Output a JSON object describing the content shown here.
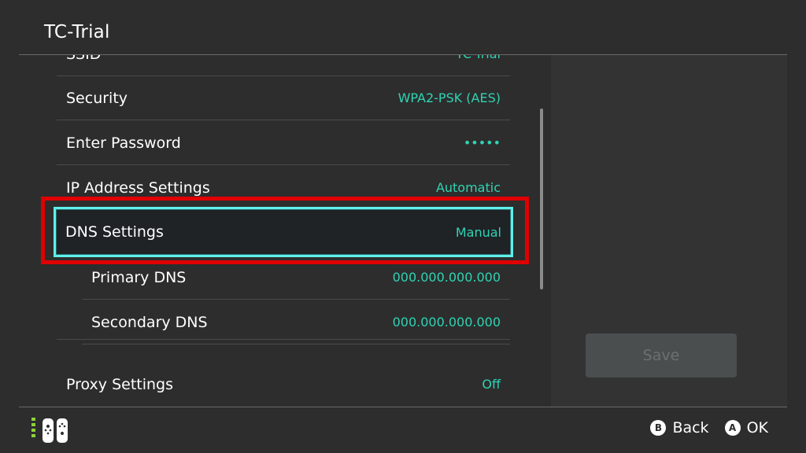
{
  "header": {
    "title": "TC-Trial"
  },
  "list": {
    "rows": [
      {
        "label": "SSID",
        "value": "TC-Trial"
      },
      {
        "label": "Security",
        "value": "WPA2-PSK (AES)"
      },
      {
        "label": "Enter Password",
        "value": "•••••"
      },
      {
        "label": "IP Address Settings",
        "value": "Automatic"
      },
      {
        "label": "DNS Settings",
        "value": "Manual",
        "selected": true
      },
      {
        "label": "Primary DNS",
        "value": "000.000.000.000"
      },
      {
        "label": "Secondary DNS",
        "value": "000.000.000.000"
      },
      {
        "label": "Proxy Settings",
        "value": "Off"
      }
    ]
  },
  "actions": {
    "save_label": "Save"
  },
  "footer": {
    "back_button_glyph": "B",
    "back_label": "Back",
    "ok_button_glyph": "A",
    "ok_label": "OK",
    "controller_icon": "joycon-icon"
  },
  "colors": {
    "background": "#2d2d2d",
    "accent_value": "#2fd3b3",
    "selection_border": "#5ff0ea",
    "annotation_red": "#e00000"
  }
}
